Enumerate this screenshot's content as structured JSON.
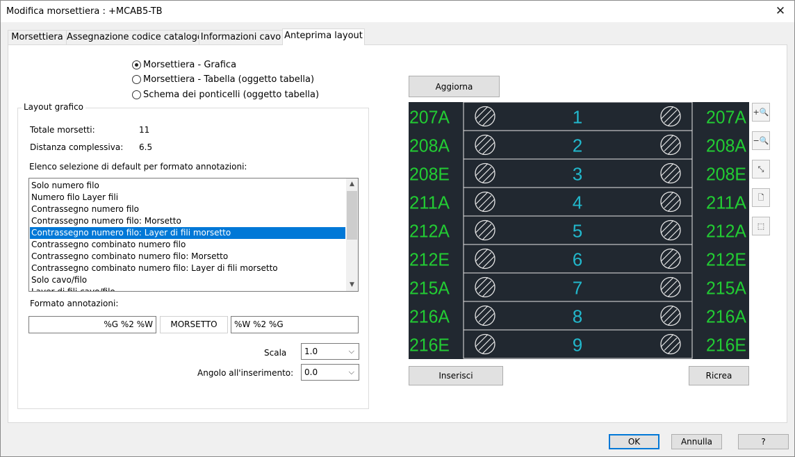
{
  "window": {
    "title": "Modifica morsettiera : +MCAB5-TB",
    "close_glyph": "✕"
  },
  "tabs": [
    {
      "label": "Morsettiera",
      "active": false
    },
    {
      "label": "Assegnazione codice catalogo",
      "active": false
    },
    {
      "label": "Informazioni cavo",
      "active": false
    },
    {
      "label": "Anteprima layout",
      "active": true
    }
  ],
  "view_options": [
    {
      "label": "Morsettiera - Grafica",
      "checked": true
    },
    {
      "label": "Morsettiera - Tabella (oggetto tabella)",
      "checked": false
    },
    {
      "label": "Schema dei ponticelli (oggetto tabella)",
      "checked": false
    }
  ],
  "layout_group": {
    "title": "Layout grafico",
    "total_label": "Totale morsetti:",
    "total_value": "11",
    "distance_label": "Distanza complessiva:",
    "distance_value": "6.5",
    "list_label": "Elenco selezione di default per formato annotazioni:",
    "list_items": [
      "Solo numero filo",
      "Numero filo Layer fili",
      "Contrassegno numero filo",
      "Contrassegno numero filo: Morsetto",
      "Contrassegno numero filo: Layer di fili morsetto",
      "Contrassegno combinato numero filo",
      "Contrassegno combinato numero filo: Morsetto",
      "Contrassegno combinato numero filo: Layer di fili morsetto",
      "Solo cavo/filo",
      "Layer di fili cavo/filo"
    ],
    "selected_index": 4,
    "format_label": "Formato annotazioni:",
    "format_left": "%G %2 %W",
    "format_middle": "MORSETTO",
    "format_right": "%W %2 %G",
    "scale_label": "Scala",
    "scale_value": "1.0",
    "angle_label": "Angolo all'inserimento:",
    "angle_value": "0.0"
  },
  "preview": {
    "refresh_label": "Aggiorna",
    "insert_label": "Inserisci",
    "recreate_label": "Ricrea",
    "colors": {
      "background": "#212830",
      "wire_text": "#22cc33",
      "terminal_text": "#22b8cc",
      "lines": "#e6e6e6"
    },
    "rows": [
      {
        "left": "207A",
        "number": "1",
        "right": "207A"
      },
      {
        "left": "208A",
        "number": "2",
        "right": "208A"
      },
      {
        "left": "208E",
        "number": "3",
        "right": "208E"
      },
      {
        "left": "211A",
        "number": "4",
        "right": "211A"
      },
      {
        "left": "212A",
        "number": "5",
        "right": "212A"
      },
      {
        "left": "212E",
        "number": "6",
        "right": "212E"
      },
      {
        "left": "215A",
        "number": "7",
        "right": "215A"
      },
      {
        "left": "216A",
        "number": "8",
        "right": "216A"
      },
      {
        "left": "216E",
        "number": "9",
        "right": "216E"
      }
    ],
    "zoom_tools": [
      {
        "name": "zoom-in-icon",
        "glyph": "+🔍"
      },
      {
        "name": "zoom-out-icon",
        "glyph": "−🔍"
      },
      {
        "name": "zoom-extents-icon",
        "glyph": "⤡"
      },
      {
        "name": "zoom-page-icon",
        "glyph": "🗋"
      },
      {
        "name": "zoom-window-icon",
        "glyph": "⬚"
      }
    ]
  },
  "footer": {
    "ok_label": "OK",
    "cancel_label": "Annulla",
    "help_label": "?"
  }
}
